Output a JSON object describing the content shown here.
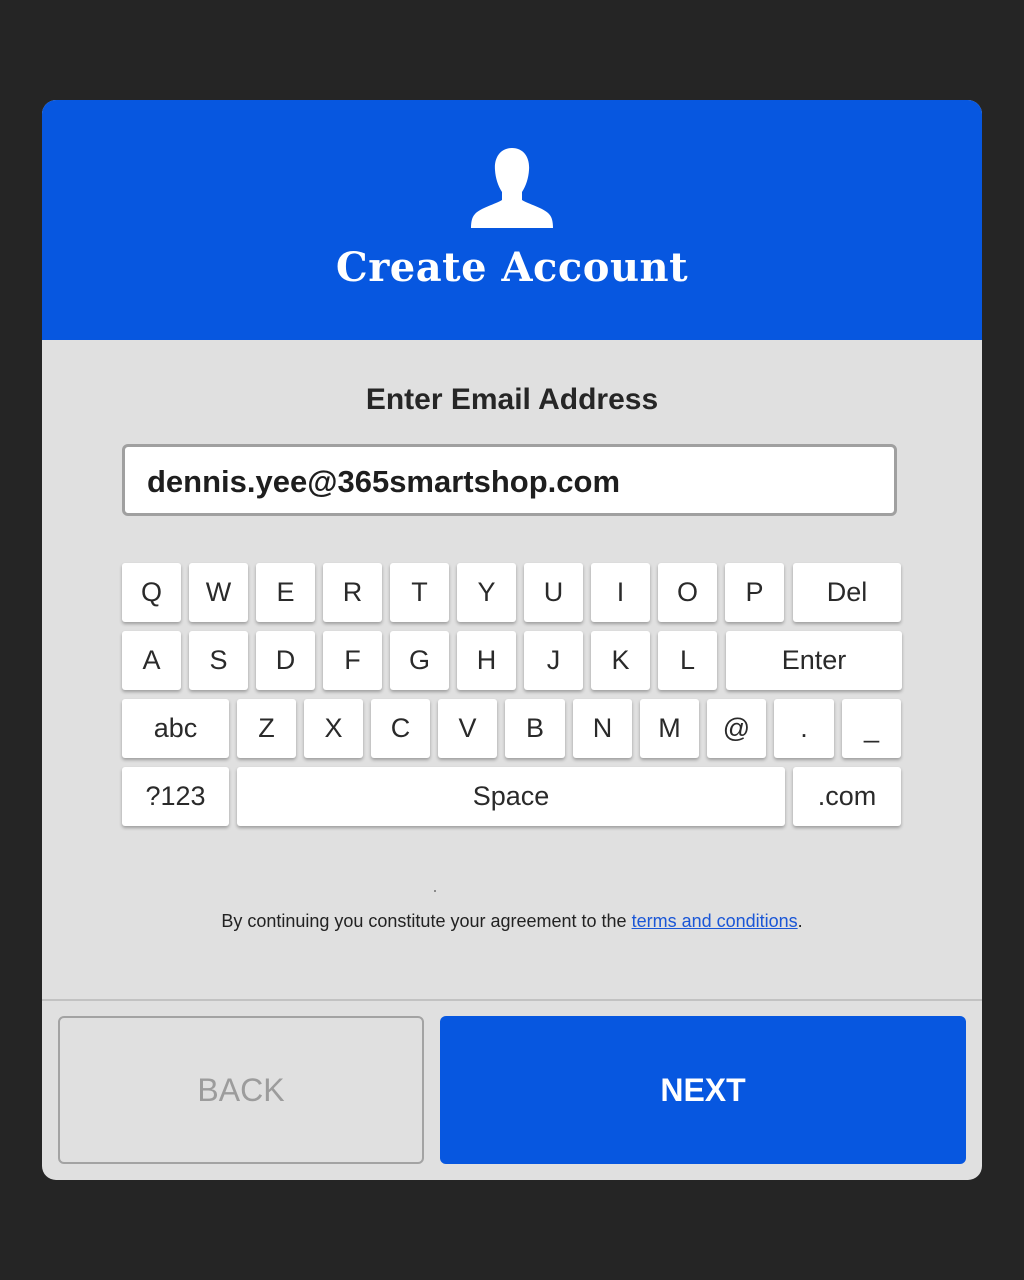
{
  "header": {
    "title": "Create Account",
    "icon": "user-icon"
  },
  "prompt": "Enter Email Address",
  "email_field": {
    "value": "dennis.yee@365smartshop.com"
  },
  "keyboard": {
    "row1": [
      "Q",
      "W",
      "E",
      "R",
      "T",
      "Y",
      "U",
      "I",
      "O",
      "P",
      "Del"
    ],
    "row2": [
      "A",
      "S",
      "D",
      "F",
      "G",
      "H",
      "J",
      "K",
      "L",
      "Enter"
    ],
    "row3": [
      "abc",
      "Z",
      "X",
      "C",
      "V",
      "B",
      "N",
      "M",
      "@",
      ".",
      "_"
    ],
    "row4": [
      "?123",
      "Space",
      ".com"
    ]
  },
  "terms": {
    "text": "By continuing you constitute your agreement to the ",
    "link": "terms and conditions",
    "suffix": "."
  },
  "footer": {
    "back_label": "BACK",
    "next_label": "NEXT"
  },
  "colors": {
    "accent": "#0757e0",
    "panel": "#e0e0e0",
    "backdrop": "#252525",
    "link": "#1a56d6"
  }
}
